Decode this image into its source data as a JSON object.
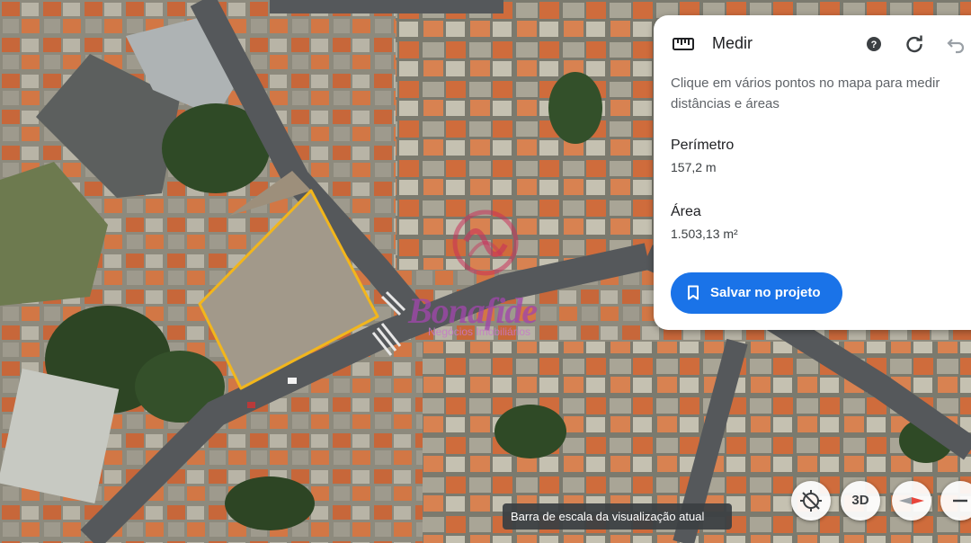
{
  "panel": {
    "title": "Medir",
    "description": "Clique em vários pontos no mapa para medir distâncias e áreas",
    "perimeter_label": "Perímetro",
    "perimeter_value": "157,2 m",
    "area_label": "Área",
    "area_value": "1.503,13 m²",
    "save_button": "Salvar no projeto",
    "accent_color": "#1a73e8"
  },
  "controls": {
    "view_3d": "3D",
    "tooltip": "Barra de escala da visualização atual"
  },
  "watermark": {
    "brand": "Bonafide",
    "tagline": "Negócios Imobiliários"
  },
  "measurement": {
    "outline_color": "#f2b61c"
  }
}
